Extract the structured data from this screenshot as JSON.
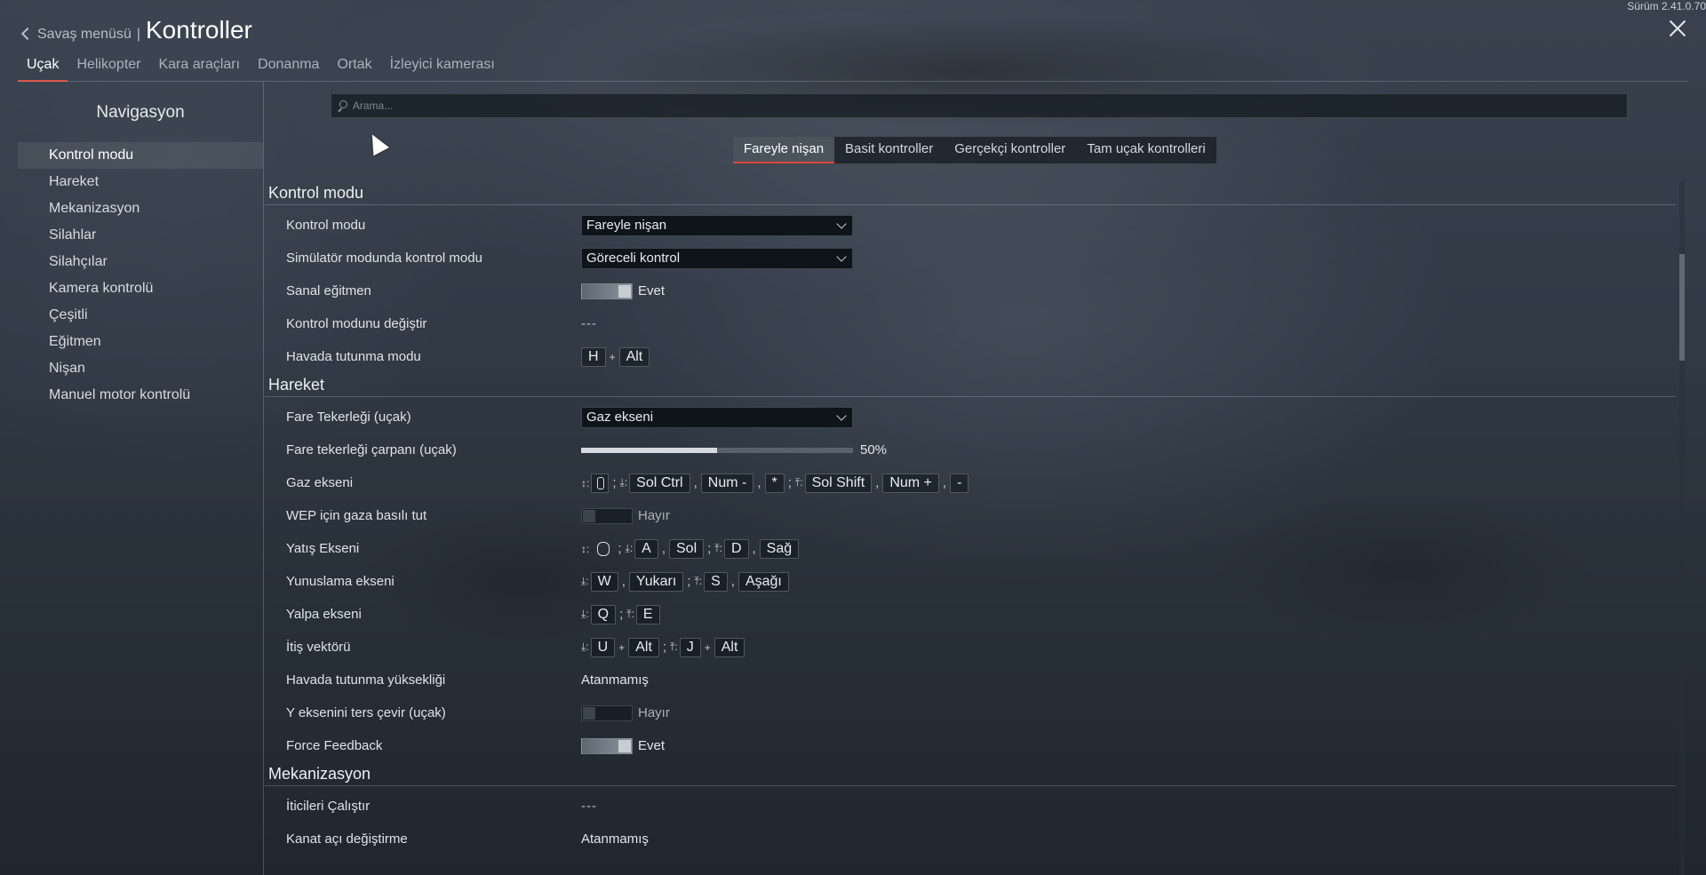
{
  "header": {
    "back_label": "Savaş menüsü",
    "separator": "|",
    "title": "Kontroller",
    "version": "Sürüm 2.41.0.70"
  },
  "vehicle_tabs": [
    "Uçak",
    "Helikopter",
    "Kara araçları",
    "Donanma",
    "Ortak",
    "İzleyici kamerası"
  ],
  "sidebar": {
    "title": "Navigasyon",
    "items": [
      "Kontrol modu",
      "Hareket",
      "Mekanizasyon",
      "Silahlar",
      "Silahçılar",
      "Kamera kontrolü",
      "Çeşitli",
      "Eğitmen",
      "Nişan",
      "Manuel motor kontrolü"
    ]
  },
  "search": {
    "placeholder": "Arama..."
  },
  "mode_tabs": [
    "Fareyle nişan",
    "Basit kontroller",
    "Gerçekçi kontroller",
    "Tam uçak kontrolleri"
  ],
  "sections": {
    "kontrol_modu": {
      "title": "Kontrol modu",
      "rows": {
        "kontrol_modu": {
          "label": "Kontrol modu",
          "value": "Fareyle nişan"
        },
        "simulator": {
          "label": "Simülatör modunda kontrol modu",
          "value": "Göreceli kontrol"
        },
        "sanal_egitmen": {
          "label": "Sanal eğitmen",
          "value": "Evet"
        },
        "degistir": {
          "label": "Kontrol modunu değiştir",
          "value": "---"
        },
        "havada_tutunma": {
          "label": "Havada tutunma modu",
          "key1": "H",
          "key2": "Alt"
        }
      }
    },
    "hareket": {
      "title": "Hareket",
      "rows": {
        "fare_tekerlegi": {
          "label": "Fare Tekerleği (uçak)",
          "value": "Gaz ekseni"
        },
        "carpani": {
          "label": "Fare tekerleği çarpanı (uçak)",
          "value": "50%",
          "fraction": 0.5
        },
        "gaz_ekseni": {
          "label": "Gaz ekseni",
          "keys": [
            "Sol Ctrl",
            "Num -",
            "*",
            "Sol Shift",
            "Num +",
            "-"
          ]
        },
        "wep": {
          "label": "WEP için gaza basılı tut",
          "value": "Hayır"
        },
        "yatis": {
          "label": "Yatış Ekseni",
          "keys": [
            "A",
            "Sol",
            "D",
            "Sağ"
          ]
        },
        "yunuslama": {
          "label": "Yunuslama ekseni",
          "keys": [
            "W",
            "Yukarı",
            "S",
            "Aşağı"
          ]
        },
        "yalpa": {
          "label": "Yalpa ekseni",
          "keys": [
            "Q",
            "E"
          ]
        },
        "itis": {
          "label": "İtiş vektörü",
          "keys": [
            "U",
            "Alt",
            "J",
            "Alt"
          ]
        },
        "yukseklik": {
          "label": "Havada tutunma yüksekliği",
          "value": "Atanmamış"
        },
        "y_ters": {
          "label": "Y eksenini ters çevir (uçak)",
          "value": "Hayır"
        },
        "force": {
          "label": "Force Feedback",
          "value": "Evet"
        }
      }
    },
    "mekanizasyon": {
      "title": "Mekanizasyon",
      "rows": {
        "iticiler": {
          "label": "İticileri Çalıştır",
          "value": "---"
        },
        "kanat": {
          "label": "Kanat açı değiştirme",
          "value": "Atanmamış"
        }
      }
    }
  },
  "glyphs": {
    "both": "↕:",
    "down": "⤓:",
    "up": "⤒:",
    "plus": "+",
    "comma": ",",
    "semicolon": ";"
  }
}
